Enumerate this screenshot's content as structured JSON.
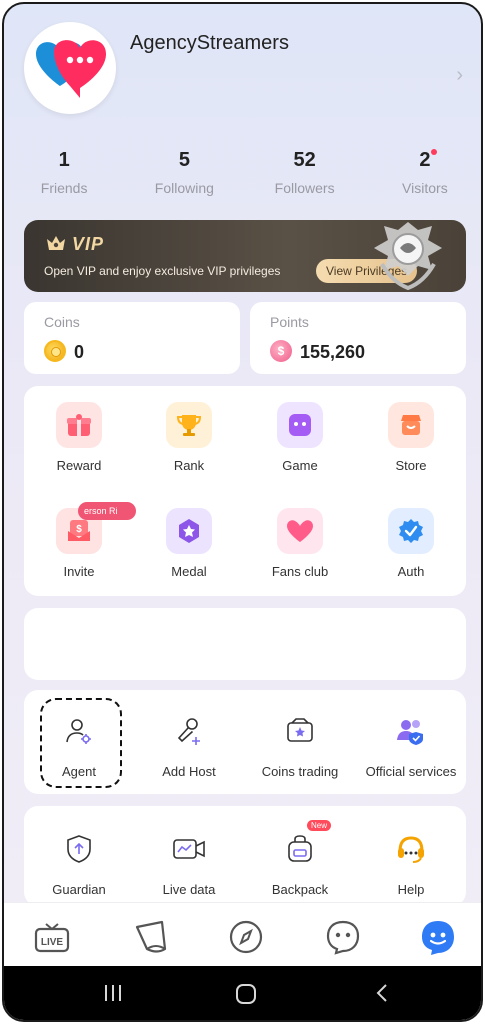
{
  "profile": {
    "username": "AgencyStreamers"
  },
  "stats": [
    {
      "value": "1",
      "label": "Friends"
    },
    {
      "value": "5",
      "label": "Following"
    },
    {
      "value": "52",
      "label": "Followers"
    },
    {
      "value": "2",
      "label": "Visitors"
    }
  ],
  "vip": {
    "title": "VIP",
    "subtitle": "Open VIP and enjoy exclusive VIP privileges",
    "button_label": "View Privileges"
  },
  "wallet": {
    "coins_label": "Coins",
    "coins_value": "0",
    "points_label": "Points",
    "points_value": "155,260"
  },
  "features": [
    {
      "label": "Reward",
      "icon": "gift-icon"
    },
    {
      "label": "Rank",
      "icon": "trophy-icon"
    },
    {
      "label": "Game",
      "icon": "gamepad-icon"
    },
    {
      "label": "Store",
      "icon": "store-icon"
    },
    {
      "label": "Invite",
      "icon": "invite-icon",
      "tag": "erson   Ri"
    },
    {
      "label": "Medal",
      "icon": "medal-icon"
    },
    {
      "label": "Fans club",
      "icon": "heart-icon"
    },
    {
      "label": "Auth",
      "icon": "verified-icon"
    }
  ],
  "tools": [
    {
      "label": "Agent",
      "icon": "agent-user-gear-icon"
    },
    {
      "label": "Add Host",
      "icon": "microphone-plus-icon"
    },
    {
      "label": "Coins trading",
      "icon": "wallet-star-icon"
    },
    {
      "label": "Official services",
      "icon": "users-shield-icon"
    }
  ],
  "more_tools": [
    {
      "label": "Guardian",
      "icon": "shield-arrow-icon"
    },
    {
      "label": "Live data",
      "icon": "video-chart-icon"
    },
    {
      "label": "Backpack",
      "icon": "backpack-icon",
      "tag": "New"
    },
    {
      "label": "Help",
      "icon": "headset-icon"
    }
  ],
  "bottom_nav": [
    {
      "name": "live-tab",
      "icon": "live-tv-icon",
      "text": "LIVE"
    },
    {
      "name": "party-tab",
      "icon": "cone-icon"
    },
    {
      "name": "explore-tab",
      "icon": "compass-icon"
    },
    {
      "name": "messages-tab",
      "icon": "chat-bubble-icon"
    },
    {
      "name": "me-tab",
      "icon": "profile-face-icon"
    }
  ],
  "colors": {
    "accent_pink": "#ef5b8a",
    "vip_gold": "#f2d7a3",
    "coin_gold": "#f6b81c",
    "active_blue": "#2f7bf5"
  }
}
